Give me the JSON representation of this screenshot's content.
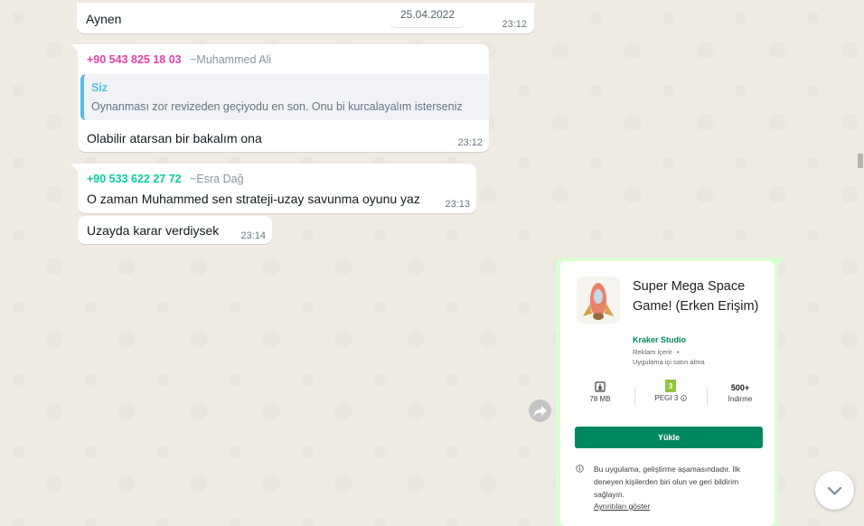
{
  "messages": [
    {
      "text": "Aynen",
      "time": "23:12"
    },
    {
      "sender_phone": "+90 543 825 18 03",
      "sender_alias": "~Muhammed Ali",
      "quote_author": "Siz",
      "quote_text": "Oynanması zor revizeden geçiyodu en son. Onu bi kurcalayalım isterseniz",
      "text": "Olabilir atarsan bir bakalım ona",
      "time": "23:12"
    },
    {
      "sender_phone": "+90 533 622 27 72",
      "sender_alias": "~Esra Dağ",
      "text": "O zaman Muhammed sen strateji-uzay savunma oyunu yaz",
      "time": "23:13"
    },
    {
      "text": "Uzayda karar verdiysek",
      "time": "23:14"
    }
  ],
  "date_chip": "25.04.2022",
  "app_card": {
    "title": "Super Mega Space Game! (Erken Erişim)",
    "developer": "Kraker Studio",
    "ads": "Reklam içerir",
    "dot": "•",
    "iap": "Uygulama içi satın alma",
    "size": "78 MB",
    "rating": "PEGI 3",
    "downloads": "500+",
    "downloads_label": "İndirme",
    "install": "Yükle",
    "notice": "Bu uygulama, geliştirme aşamasındadır. İlk deneyen kişilerden biri olun ve geri bildirim sağlayın.",
    "details_link": "Ayrıntıları göster"
  },
  "colors": {
    "background": "#efeae2",
    "sender1": "#e542a3",
    "sender2": "#06cf9c",
    "quote_bar": "#53bdeb",
    "install_button": "#01875f",
    "developer": "#01875f"
  },
  "icons": [
    "forward-icon",
    "chevron-down-icon",
    "download-icon",
    "pegi-icon",
    "info-icon"
  ]
}
